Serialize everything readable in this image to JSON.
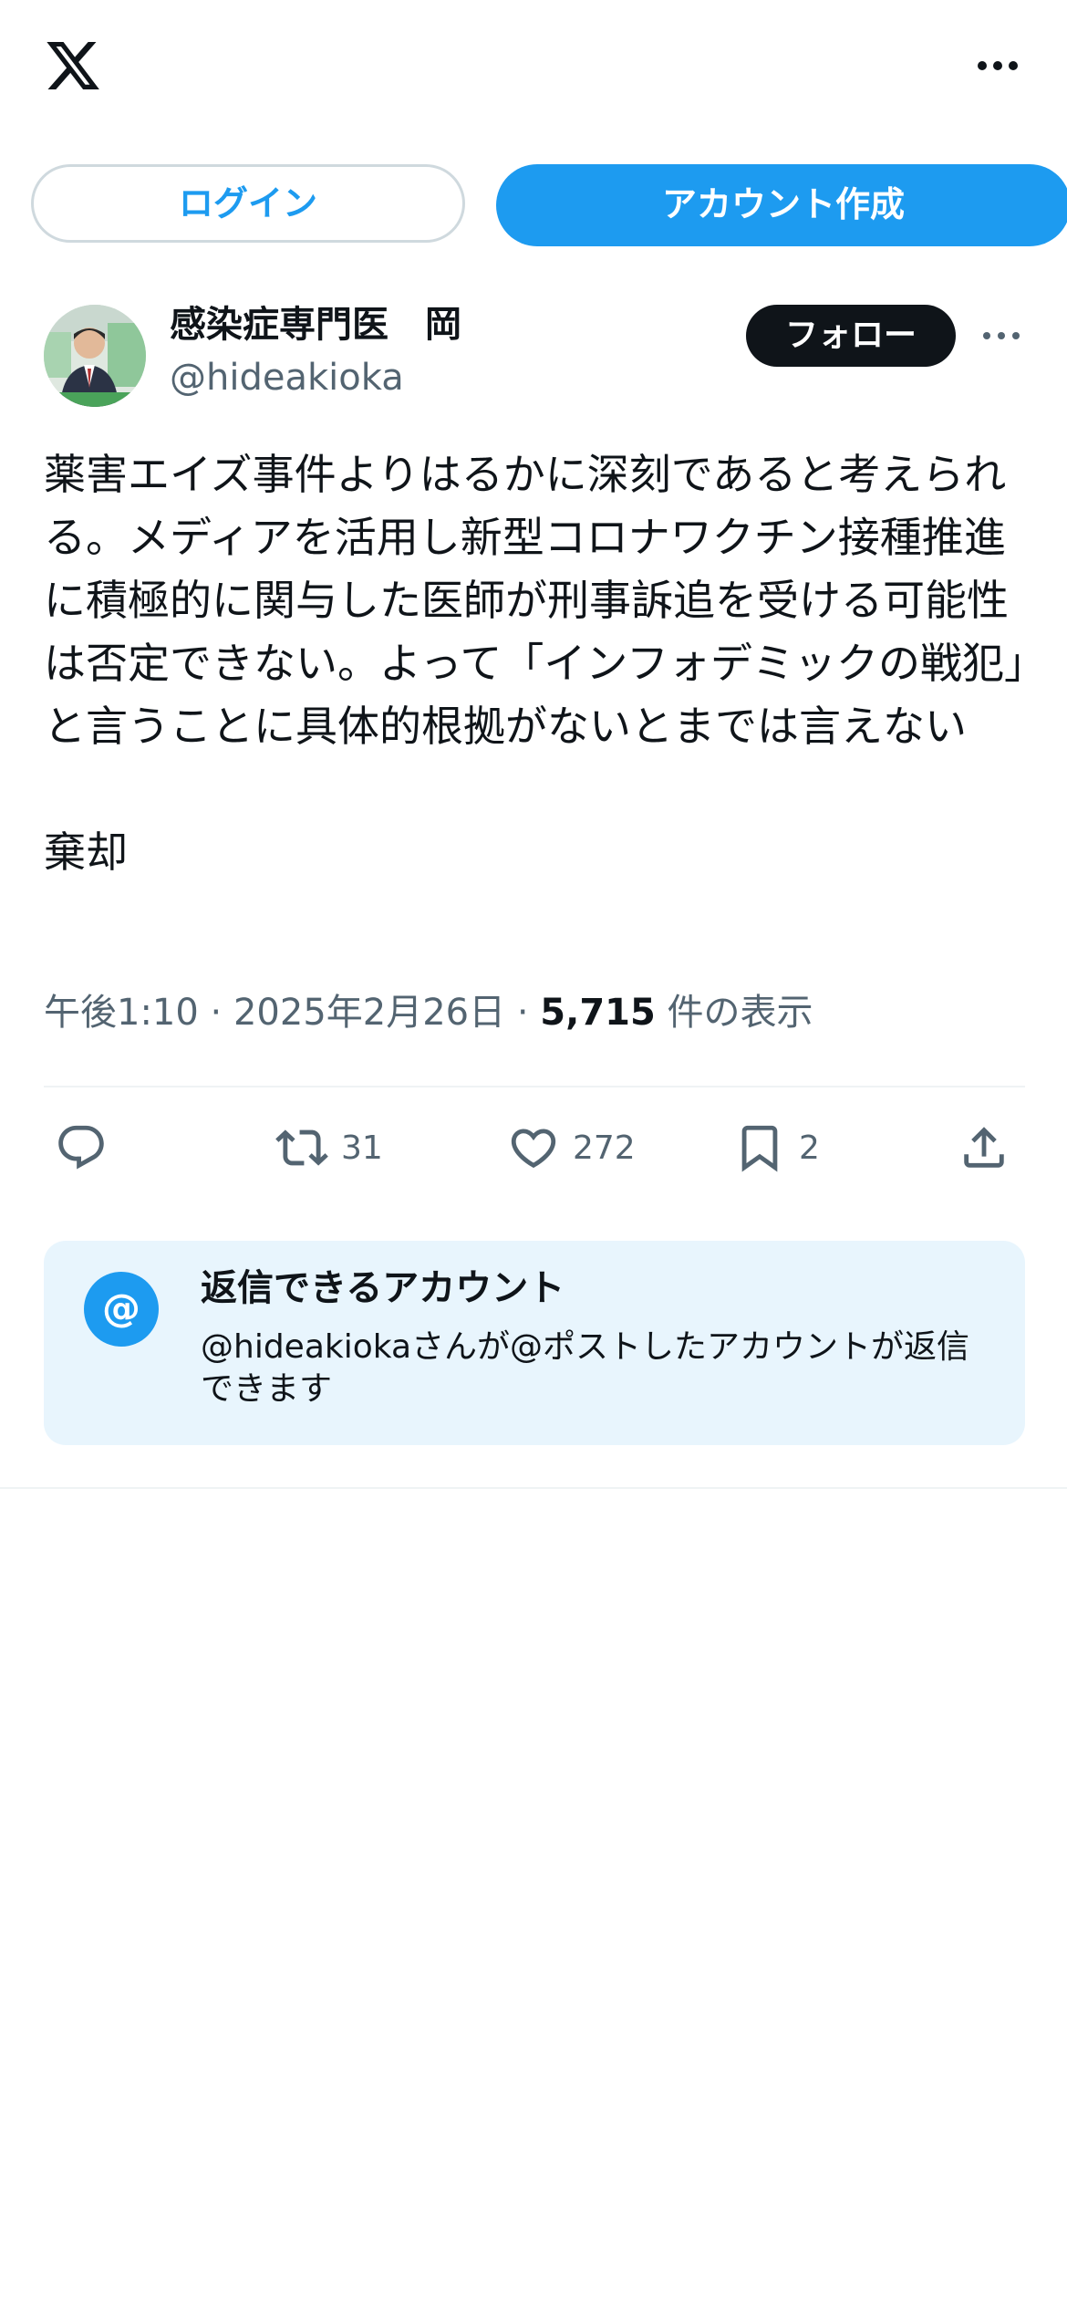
{
  "header": {
    "logo_icon": "x-logo-icon",
    "more_icon": "more-horizontal-icon"
  },
  "auth": {
    "login_label": "ログイン",
    "signup_label": "アカウント作成"
  },
  "author": {
    "name": "感染症専門医　岡",
    "handle": "@hideakioka",
    "follow_label": "フォロー"
  },
  "tweet": {
    "text": "薬害エイズ事件よりはるかに深刻であると考えられる。メディアを活用し新型コロナワクチン接種推進に積極的に関与した医師が刑事訴追を受ける可能性は否定できない。よって「インフォデミックの戦犯」と言うことに具体的根拠がないとまでは言えない\n\n棄却",
    "time": "午後1:10",
    "date": "2025年2月26日",
    "views_count": "5,715",
    "views_label": "件の表示",
    "separator": "·"
  },
  "actions": {
    "reply_icon": "reply-icon",
    "retweet_icon": "retweet-icon",
    "retweet_count": "31",
    "like_icon": "heart-icon",
    "like_count": "272",
    "bookmark_icon": "bookmark-icon",
    "bookmark_count": "2",
    "share_icon": "share-icon"
  },
  "reply_settings": {
    "icon_glyph": "@",
    "title": "返信できるアカウント",
    "description": "@hideakiokaさんが@ポストしたアカウントが返信できます"
  },
  "colors": {
    "accent": "#1d9bf0",
    "text": "#0f1419",
    "muted": "#536471",
    "info_bg": "#e8f5fd"
  }
}
